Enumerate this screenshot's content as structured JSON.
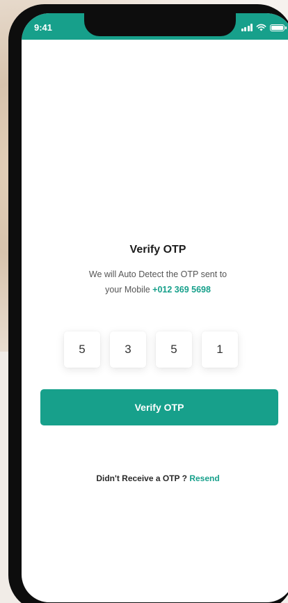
{
  "status_bar": {
    "time": "9:41",
    "icons": [
      "signal-icon",
      "wifi-icon",
      "battery-icon"
    ],
    "color": "#17a08b"
  },
  "verify": {
    "title": "Verify OTP",
    "subtitle_line1": "We will Auto Detect the OTP sent to",
    "subtitle_prefix": "your Mobile",
    "phone_number": "+012 369 5698",
    "otp_digits": [
      "5",
      "3",
      "5",
      "1"
    ],
    "button_label": "Verify OTP"
  },
  "resend": {
    "prompt": "Didn't Receive a OTP ?",
    "link_label": "Resend"
  },
  "colors": {
    "accent": "#17a08b",
    "text_dark": "#1c1c1c",
    "text_muted": "#555555"
  }
}
